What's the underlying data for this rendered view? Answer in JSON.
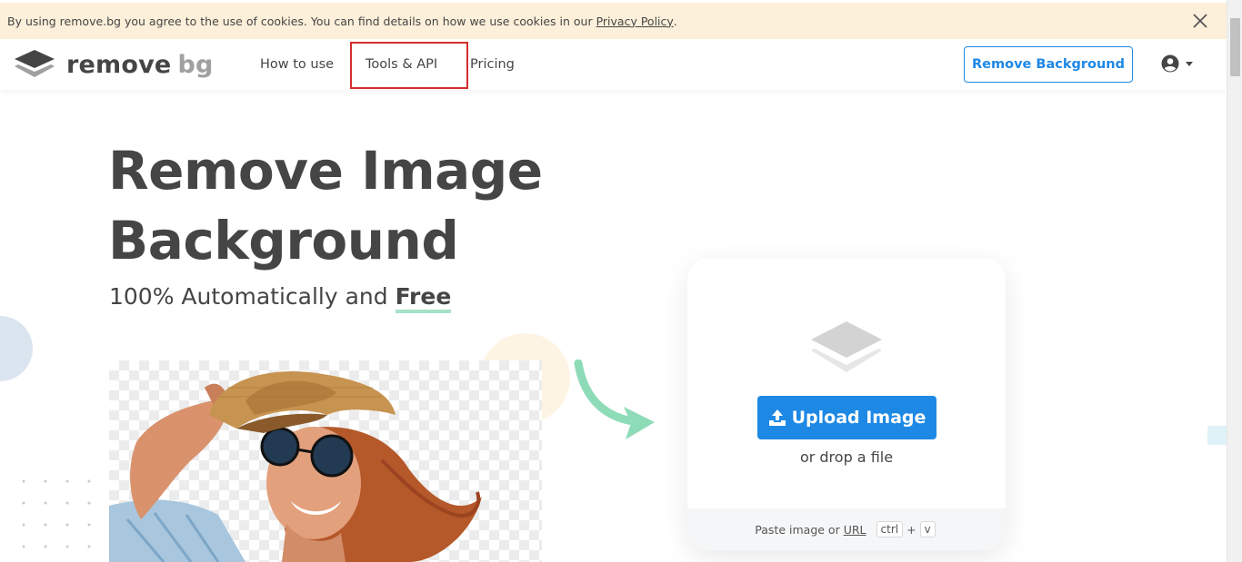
{
  "cookie_bar": {
    "text": "By using remove.bg you agree to the use of cookies. You can find details on how we use cookies in our",
    "link_label": "Privacy Policy",
    "period": ".",
    "close_icon": "close-icon"
  },
  "nav": {
    "logo_remove": "remove",
    "logo_bg": "bg",
    "links": [
      "How to use",
      "Tools & API",
      "Pricing"
    ],
    "cta_label": "Remove Background",
    "user_icon": "user-circle-icon"
  },
  "hero": {
    "title_line1": "Remove Image",
    "title_line2": "Background",
    "subtitle_prefix": "100% Automatically and",
    "subtitle_free": "Free"
  },
  "upload": {
    "button_label": "Upload Image",
    "drop_text": "or drop a file",
    "paste_prefix": "Paste image or",
    "paste_url": "URL",
    "key_ctrl": "ctrl",
    "key_plus": "+",
    "key_v": "v"
  },
  "colors": {
    "accent": "#1e88e5",
    "text": "#454545",
    "cookie_bg": "#fdf0da",
    "highlight_box": "#d32f2f",
    "free_underline": "#a5e2c8"
  }
}
